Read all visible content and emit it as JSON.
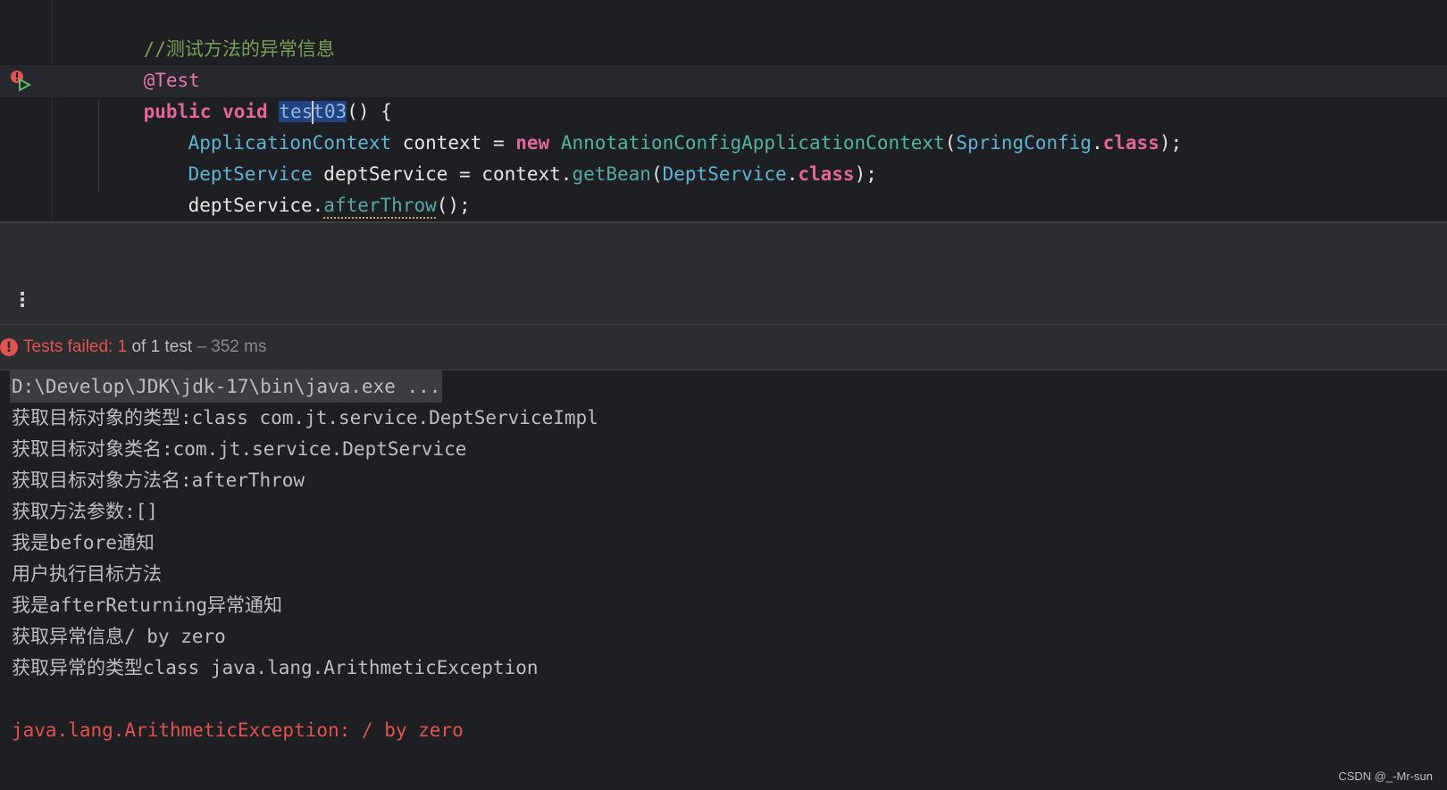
{
  "editor": {
    "comment": "//测试方法的异常信息",
    "annotation": "@Test",
    "signature": {
      "kw_public": "public",
      "kw_void": "void",
      "method_sel_a": "tes",
      "method_sel_b": "t03",
      "tail": "() {"
    },
    "line_context": {
      "type": "ApplicationContext",
      "var": " context = ",
      "kw_new": "new",
      "ctor": " AnnotationConfigApplicationContext",
      "open": "(",
      "cls": "SpringConfig",
      "dot": ".",
      "kw_class": "class",
      "close": ");"
    },
    "line_service": {
      "type": "DeptService",
      "var": " deptService = context.",
      "call": "getBean",
      "open": "(",
      "cls": "DeptService",
      "dot": ".",
      "kw_class": "class",
      "close": ");"
    },
    "line_call": {
      "obj": "deptService.",
      "call": "afterThrow",
      "close": "();"
    },
    "closing_brace": "}"
  },
  "run_panel": {
    "more_icon": "⋮",
    "status": {
      "failed_label": "Tests failed: 1",
      "of_label": " of 1 test",
      "time_label": " – 352 ms"
    },
    "console_lines": [
      "D:\\Develop\\JDK\\jdk-17\\bin\\java.exe ...",
      "获取目标对象的类型:class com.jt.service.DeptServiceImpl",
      "获取目标对象类名:com.jt.service.DeptService",
      "获取目标对象方法名:afterThrow",
      "获取方法参数:[]",
      "我是before通知",
      "用户执行目标方法",
      "我是afterReturning异常通知",
      "获取异常信息/ by zero",
      "获取异常的类型class java.lang.ArithmeticException",
      "",
      "java.lang.ArithmeticException: / by zero"
    ]
  },
  "watermark": "CSDN @_-Mr-sun",
  "colors": {
    "background": "#1e1f22",
    "panel": "#2b2d30",
    "error": "#e2534f",
    "keyword": "#e3669a",
    "type": "#5fb4d4",
    "comment": "#7a9e58"
  }
}
